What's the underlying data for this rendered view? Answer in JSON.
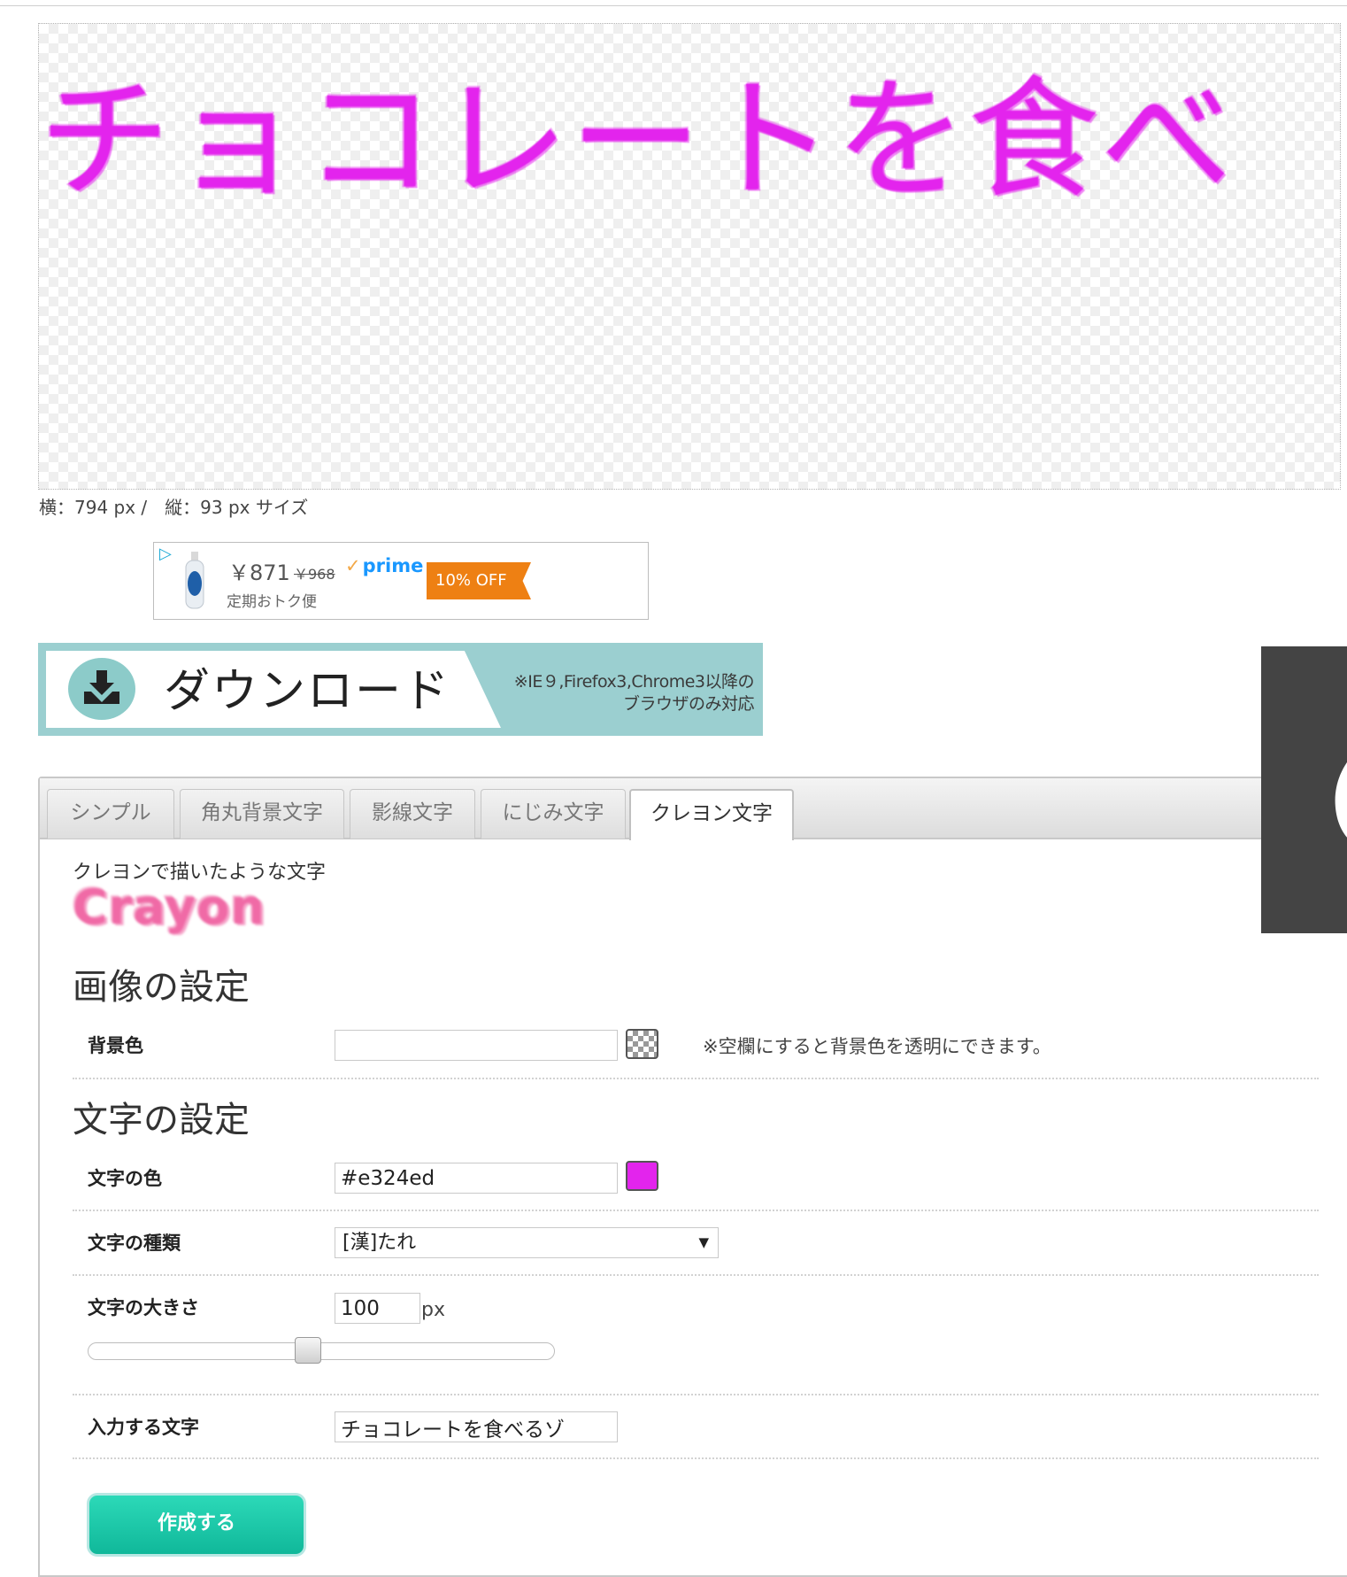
{
  "preview": {
    "text": "チョコレートを食べ",
    "size_label": "横：794 px /　縦：93 px サイズ"
  },
  "ad": {
    "price": "￥871",
    "old_price": "￥968",
    "prime_label": "prime",
    "subtitle": "定期おトク便",
    "discount": "10% OFF"
  },
  "download": {
    "label": "ダウンロード",
    "note_line1": "※IE９,Firefox3,Chrome3以降の",
    "note_line2": "ブラウザのみ対応"
  },
  "tabs": [
    {
      "label": "シンプル",
      "active": false
    },
    {
      "label": "角丸背景文字",
      "active": false
    },
    {
      "label": "影線文字",
      "active": false
    },
    {
      "label": "にじみ文字",
      "active": false
    },
    {
      "label": "クレヨン文字",
      "active": true
    }
  ],
  "description": "クレヨンで描いたような文字",
  "sample_text": "Crayon",
  "image_settings": {
    "heading": "画像の設定",
    "bg_label": "背景色",
    "bg_value": "",
    "bg_note": "※空欄にすると背景色を透明にできます。"
  },
  "text_settings": {
    "heading": "文字の設定",
    "color_label": "文字の色",
    "color_value": "#e324ed",
    "font_label": "文字の種類",
    "font_value": "[漢]たれ",
    "size_label": "文字の大きさ",
    "size_value": "100",
    "size_unit": "px",
    "size_slider_fraction": 0.47,
    "input_label": "入力する文字",
    "input_value": "チョコレートを食べるゾ"
  },
  "make_button": "作成する",
  "colors": {
    "text_color": "#e324ed",
    "sample_color": "#f06aa6",
    "banner": "#9bcfd0",
    "discount": "#ee8013",
    "button": "#1cc7a8"
  },
  "overlay_glyph": "の"
}
